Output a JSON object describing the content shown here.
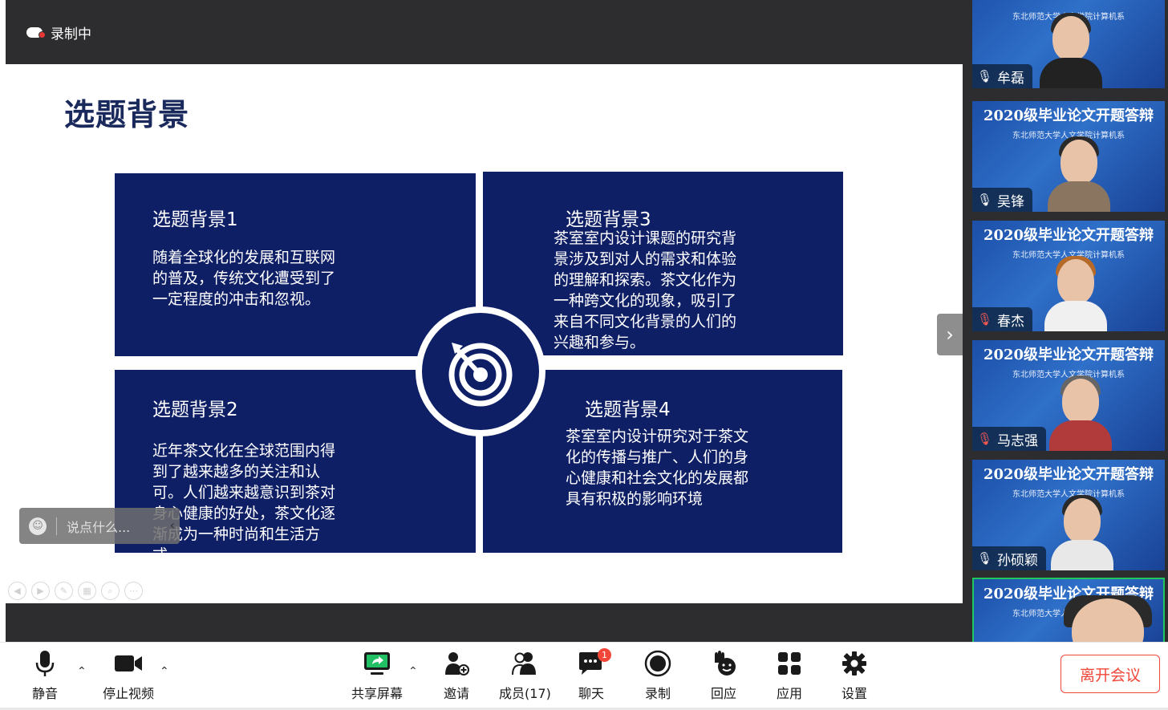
{
  "recording": {
    "label": "录制中"
  },
  "slide": {
    "title": "选题背景",
    "panels": [
      {
        "heading": "选题背景1",
        "body": "随着全球化的发展和互联网\n的普及，传统文化遭受到了\n一定程度的冲击和忽视。"
      },
      {
        "heading": "选题背景2",
        "body": "近年茶文化在全球范围内得\n到了越来越多的关注和认\n可。人们越来越意识到茶对\n身心健康的好处，茶文化逐\n渐成为一种时尚和生活方\n式"
      },
      {
        "heading": "选题背景3",
        "body": "茶室室内设计课题的研究背\n景涉及到对人的需求和体验\n的理解和探索。茶文化作为\n一种跨文化的现象，吸引了\n来自不同文化背景的人们的\n兴趣和参与。"
      },
      {
        "heading": "选题背景4",
        "body": "茶室室内设计研究对于茶文\n化的传播与推广、人们的身\n心健康和社会文化的发展都\n具有积极的影响环境"
      }
    ],
    "center_icon": "target-icon",
    "accent_color": "#0f1f66"
  },
  "comment": {
    "placeholder": "说点什么..."
  },
  "gallery": {
    "banner": "2020级毕业论文开题答辩",
    "subtitle": "东北师范大学人文学院计算机系",
    "participants": [
      {
        "name": "牟磊",
        "mic": "on"
      },
      {
        "name": "吴锋",
        "mic": "on"
      },
      {
        "name": "春杰",
        "mic": "muted"
      },
      {
        "name": "马志强",
        "mic": "muted"
      },
      {
        "name": "孙硕颖",
        "mic": "on"
      },
      {
        "name": "",
        "mic": "on"
      }
    ]
  },
  "toolbar": {
    "mute": "静音",
    "stop_video": "停止视频",
    "share_screen": "共享屏幕",
    "invite": "邀请",
    "members": "成员(17)",
    "chat": "聊天",
    "chat_badge": "1",
    "record": "录制",
    "react": "回应",
    "apps": "应用",
    "settings": "设置",
    "leave": "离开会议"
  }
}
